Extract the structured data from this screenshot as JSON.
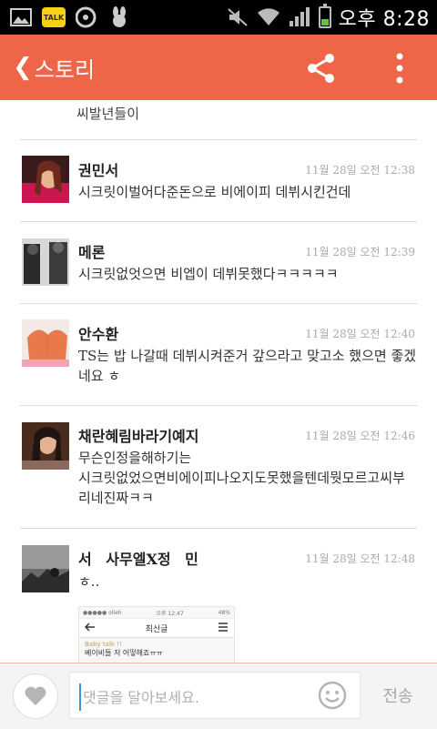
{
  "status_bar": {
    "kakao_label": "TALK",
    "ampm": "오후",
    "time": "8:28"
  },
  "header": {
    "back_label": "스토리",
    "accent_color": "#ee6548"
  },
  "icons": {
    "back": "chevron-left-icon",
    "share": "share-icon",
    "more": "more-vertical-icon",
    "like": "heart-icon",
    "emoji": "smiley-icon"
  },
  "comments": {
    "partial_text": "씨발년들이",
    "items": [
      {
        "name": "권민서",
        "time": "11월 28일 오전 12:38",
        "text": "시크릿이벌어다준돈으로 비에이피 데뷔시킨건데"
      },
      {
        "name": "메론",
        "time": "11월 28일 오전 12:39",
        "text": "시크릿없엇으면 비엡이 데뷔못했다ㅋㅋㅋㅋㅋ"
      },
      {
        "name": "안수환",
        "time": "11월 28일 오전 12:40",
        "text": "TS는 밥 나갈때 데뷔시켜준거 갚으라고 맞고소 했으면 좋겠네요 ㅎ"
      },
      {
        "name": "채란혜림바라기예지",
        "time": "11월 28일 오전 12:46",
        "text": "무슨인정을해하기는\n시크릿없었으면비에이피나오지도못했을텐데뭣모르고씨부리네진짜ㅋㅋ"
      },
      {
        "name": "서 사무엘X정 민",
        "time": "11월 28일 오전 12:48",
        "text": "ㅎ.."
      }
    ]
  },
  "attachment": {
    "carrier": "●●●●● olleh",
    "status_time": "오후 12:47",
    "battery": "48%",
    "screen_title": "최신글",
    "post_line1": "Baby talk !!",
    "post_line2": "베이비들 저 어떻해죠ㅠㅠ"
  },
  "input_bar": {
    "placeholder": "댓글을 달아보세요.",
    "send_label": "전송"
  }
}
